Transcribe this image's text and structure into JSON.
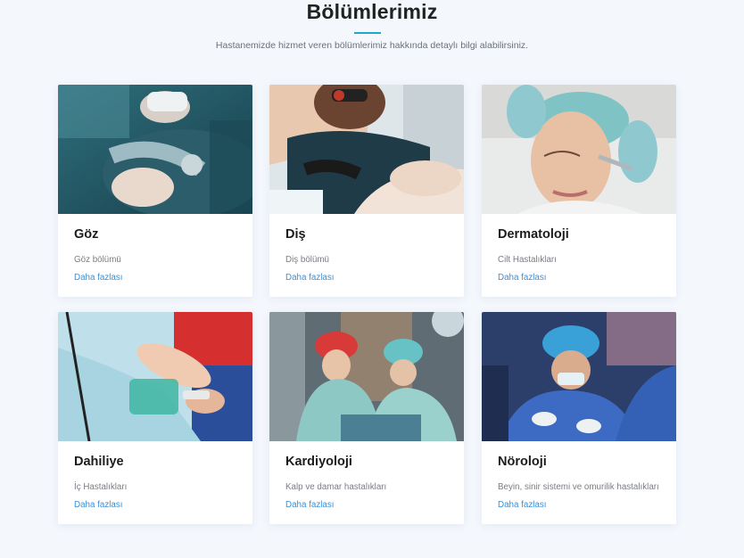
{
  "section": {
    "title": "Bölümlerimiz",
    "subtitle": "Hastanemizde hizmet veren bölümlerimiz hakkında detaylı bilgi alabilirsiniz."
  },
  "cards": [
    {
      "title": "Göz",
      "desc": "Göz bölümü",
      "link": "Daha fazlası",
      "image": "eye-surgery-photo"
    },
    {
      "title": "Diş",
      "desc": "Diş bölümü",
      "link": "Daha fazlası",
      "image": "dental-exam-photo"
    },
    {
      "title": "Dermatoloji",
      "desc": "Cilt Hastalıkları",
      "link": "Daha fazlası",
      "image": "skin-treatment-photo"
    },
    {
      "title": "Dahiliye",
      "desc": "İç Hastalıkları",
      "link": "Daha fazlası",
      "image": "iv-drip-photo"
    },
    {
      "title": "Kardiyoloji",
      "desc": "Kalp ve damar hastalıkları",
      "link": "Daha fazlası",
      "image": "heart-surgery-photo"
    },
    {
      "title": "Nöroloji",
      "desc": "Beyin, sinir sistemi ve omurilik hastalıkları",
      "link": "Daha fazlası",
      "image": "neuro-surgery-photo"
    }
  ],
  "colors": {
    "accent": "#1fa8c9",
    "link": "#3b8fd6",
    "background": "#f4f8fd"
  }
}
